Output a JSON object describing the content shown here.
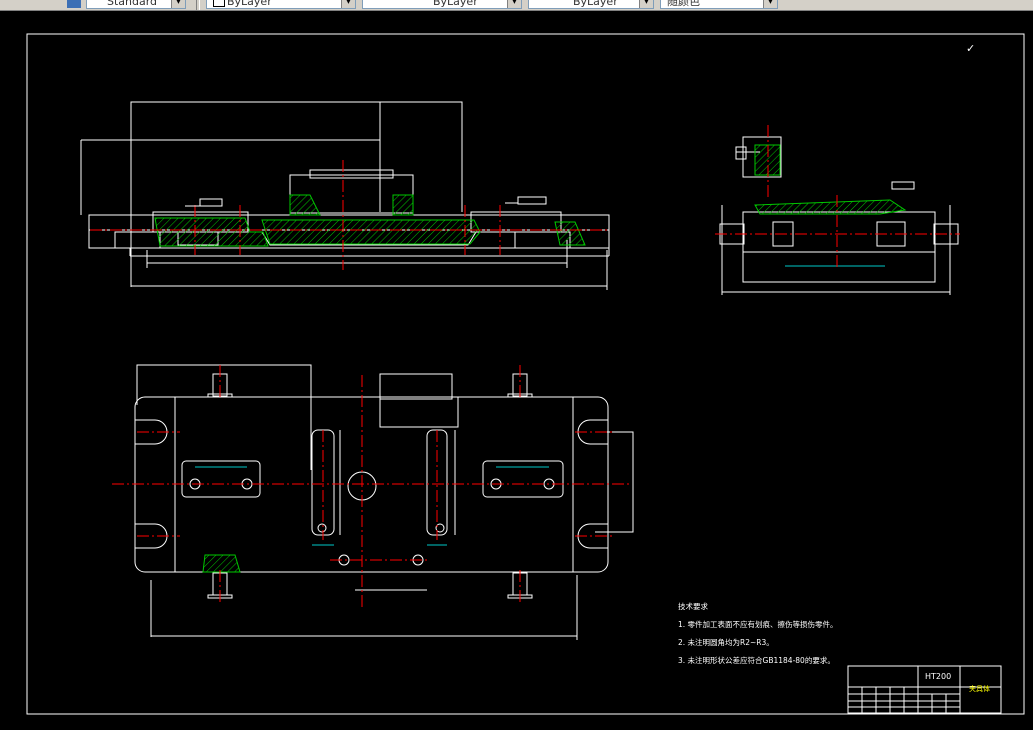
{
  "toolbar": {
    "text_style_value": "Standard",
    "layer_value": "ByLayer",
    "linetype_value": "ByLayer",
    "lineweight_value": "ByLayer",
    "color_value": "随颜色"
  },
  "drawing": {
    "roughness_symbol": "✓",
    "material": "HT200",
    "part_name": "夹具体",
    "tech_requirements_title": "技术要求",
    "tech_requirements": [
      "1. 零件加工表面不应有划痕、擦伤等损伤零件。",
      "2. 未注明圆角均为R2~R3。",
      "3. 未注明形状公差应符合GB1184-80的要求。"
    ]
  },
  "colors": {
    "background": "#000000",
    "outline": "#ffffff",
    "centerline": "#ff0000",
    "hatch": "#00c800",
    "dimension": "#00c8c8",
    "title_text": "#ffff00"
  }
}
